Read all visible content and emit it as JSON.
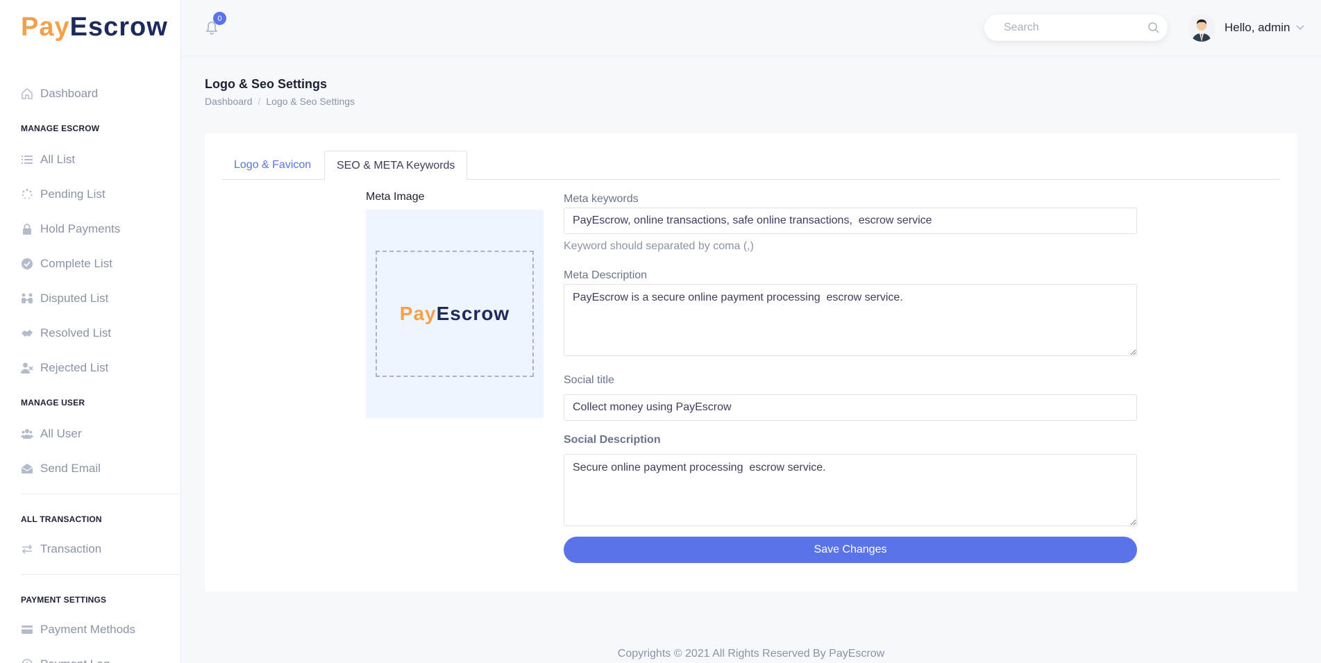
{
  "brand": {
    "pay": "Pay",
    "escrow": "Escrow"
  },
  "sidebar": {
    "dashboard": "Dashboard",
    "sections": {
      "manage_escrow": "MANAGE ESCROW",
      "manage_user": "MANAGE USER",
      "all_transaction": "ALL TRANSACTION",
      "payment_settings": "PAYMENT SETTINGS"
    },
    "items": {
      "all_list": "All List",
      "pending_list": "Pending List",
      "hold_payments": "Hold Payments",
      "complete_list": "Complete List",
      "disputed_list": "Disputed List",
      "resolved_list": "Resolved List",
      "rejected_list": "Rejected List",
      "all_user": "All User",
      "send_email": "Send Email",
      "transaction": "Transaction",
      "payment_methods": "Payment Methods",
      "payment_log": "Payment Log"
    }
  },
  "topbar": {
    "notification_count": "0",
    "search_placeholder": "Search",
    "greeting": "Hello, admin"
  },
  "page": {
    "title": "Logo & Seo Settings",
    "breadcrumb": [
      "Dashboard",
      "/",
      "Logo & Seo Settings"
    ]
  },
  "tabs": {
    "logo_favicon": "Logo & Favicon",
    "seo_meta": "SEO & META Keywords"
  },
  "meta_image": {
    "label": "Meta Image"
  },
  "form": {
    "meta_keywords_label": "Meta keywords",
    "meta_keywords_value": "PayEscrow, online transactions, safe online transactions,  escrow service",
    "meta_keywords_hint": "Keyword should separated by coma (,)",
    "meta_description_label": "Meta Description",
    "meta_description_value": "PayEscrow is a secure online payment processing  escrow service.",
    "social_title_label": "Social title",
    "social_title_value": "Collect money using PayEscrow",
    "social_description_label": "Social Description",
    "social_description_value": "Secure online payment processing  escrow service.",
    "save_label": "Save Changes"
  },
  "footer": {
    "text": "Copyrights © 2021 All Rights Reserved By PayEscrow"
  },
  "colors": {
    "accent": "#5b73e8",
    "brand_orange": "#f5a04a",
    "brand_navy": "#1e2a5a"
  }
}
